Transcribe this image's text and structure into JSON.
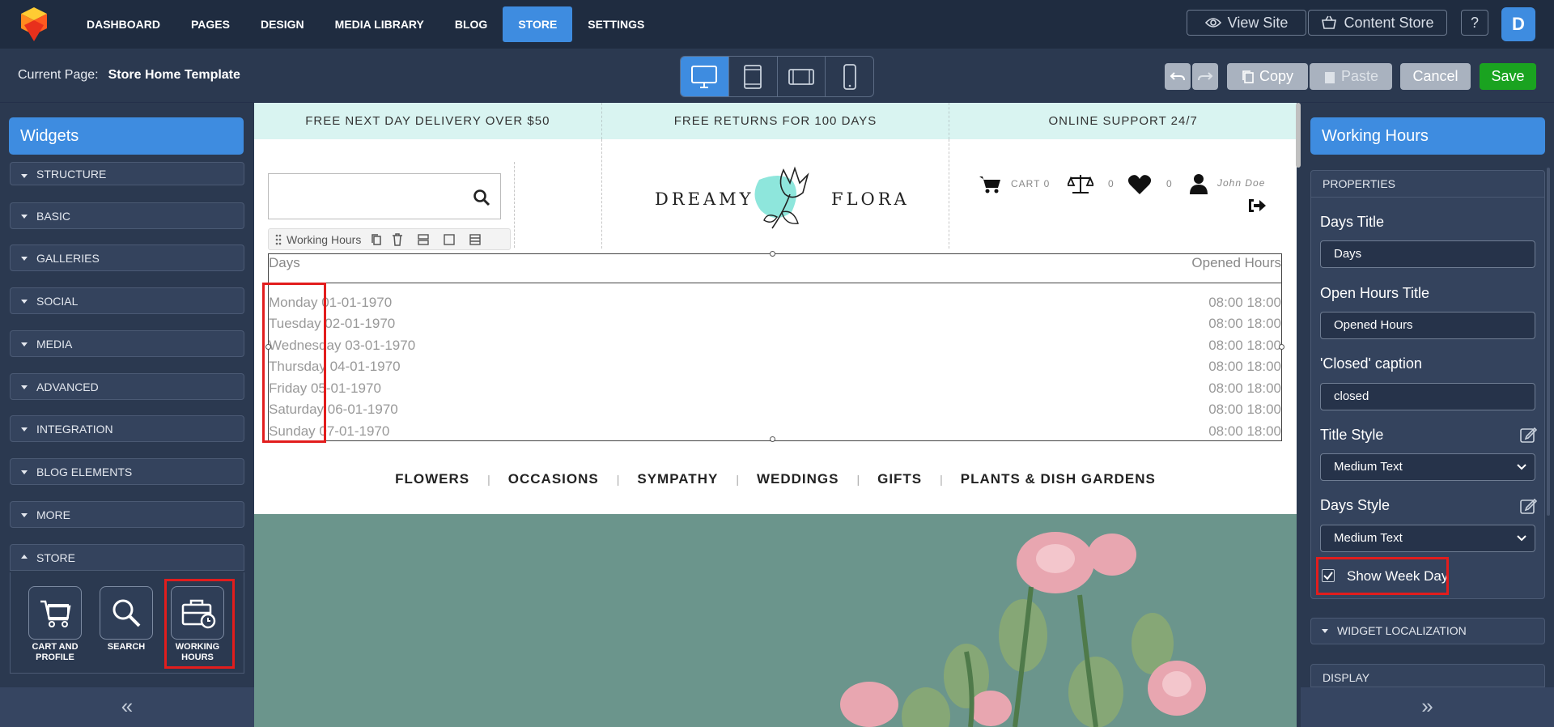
{
  "topbar": {
    "nav": [
      "DASHBOARD",
      "PAGES",
      "DESIGN",
      "MEDIA LIBRARY",
      "BLOG",
      "STORE",
      "SETTINGS"
    ],
    "active_nav": "STORE",
    "view_site": "View Site",
    "content_store": "Content Store",
    "help": "?",
    "avatar_letter": "D"
  },
  "editor_bar": {
    "current_page_label": "Current Page:",
    "current_page_name": "Store Home Template",
    "copy": "Copy",
    "paste": "Paste",
    "cancel": "Cancel",
    "save": "Save"
  },
  "left_panel": {
    "title": "Widgets",
    "categories": [
      "STRUCTURE",
      "BASIC",
      "GALLERIES",
      "SOCIAL",
      "MEDIA",
      "ADVANCED",
      "INTEGRATION",
      "BLOG ELEMENTS",
      "MORE",
      "STORE"
    ],
    "store_widgets": [
      {
        "line1": "CART AND",
        "line2": "PROFILE",
        "icon": "cart-icon"
      },
      {
        "line1": "SEARCH",
        "line2": "",
        "icon": "magnifier-icon"
      },
      {
        "line1": "WORKING",
        "line2": "HOURS",
        "icon": "briefcase-clock-icon"
      }
    ],
    "collapse": "«"
  },
  "canvas": {
    "promo": [
      "FREE NEXT DAY DELIVERY OVER $50",
      "FREE RETURNS FOR 100 DAYS",
      "ONLINE SUPPORT 24/7"
    ],
    "brand_left": "DREAMY",
    "brand_right": "FLORA",
    "cart": "CART 0",
    "compare_count": "0",
    "wishlist_count": "0",
    "user": "John Doe",
    "widget_toolbar_label": "Working Hours",
    "working_hours": {
      "days_title": "Days",
      "hours_title": "Opened Hours",
      "rows": [
        {
          "day": "Monday 01-01-1970",
          "hours": "08:00 18:00"
        },
        {
          "day": "Tuesday 02-01-1970",
          "hours": "08:00 18:00"
        },
        {
          "day": "Wednesday 03-01-1970",
          "hours": "08:00 18:00"
        },
        {
          "day": "Thursday 04-01-1970",
          "hours": "08:00 18:00"
        },
        {
          "day": "Friday 05-01-1970",
          "hours": "08:00 18:00"
        },
        {
          "day": "Saturday 06-01-1970",
          "hours": "08:00 18:00"
        },
        {
          "day": "Sunday 07-01-1970",
          "hours": "08:00 18:00"
        }
      ]
    },
    "category_nav": [
      "FLOWERS",
      "OCCASIONS",
      "SYMPATHY",
      "WEDDINGS",
      "GIFTS",
      "PLANTS & DISH GARDENS"
    ]
  },
  "right_panel": {
    "title": "Working Hours",
    "properties_header": "PROPERTIES",
    "days_title_label": "Days Title",
    "days_title_value": "Days",
    "open_hours_title_label": "Open Hours Title",
    "open_hours_title_value": "Opened Hours",
    "closed_caption_label": "'Closed' caption",
    "closed_caption_value": "closed",
    "title_style_label": "Title Style",
    "title_style_value": "Medium Text",
    "days_style_label": "Days Style",
    "days_style_value": "Medium Text",
    "show_week_day_label": "Show Week Day",
    "show_week_day_checked": true,
    "widget_localization": "WIDGET LOCALIZATION",
    "display": "DISPLAY",
    "collapse": "»"
  },
  "colors": {
    "accent": "#3e8ce0",
    "save_green": "#1aa320",
    "highlight_red": "#e21d1d",
    "promo_bg": "#d9f4f1",
    "hero_bg": "#6b958c"
  }
}
